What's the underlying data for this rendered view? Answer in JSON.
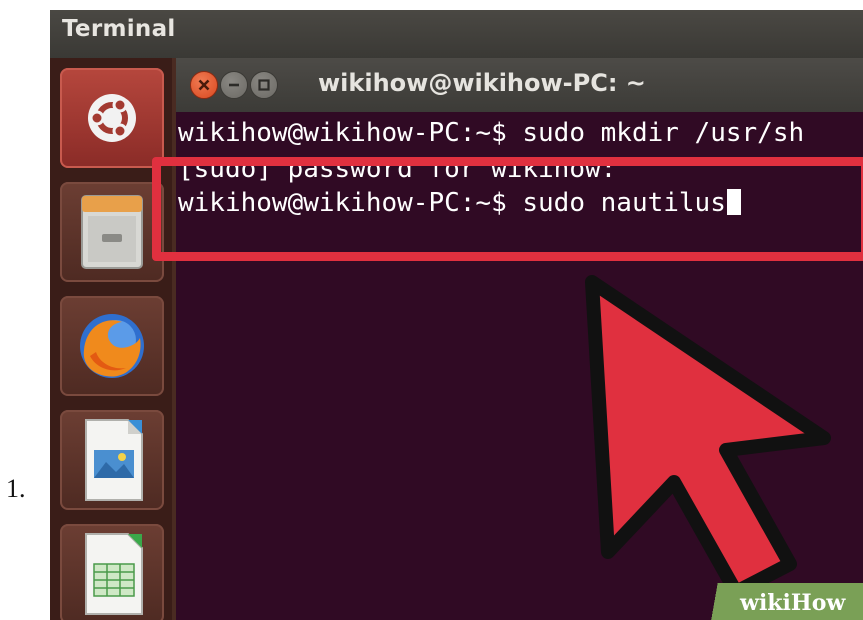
{
  "list_number": "1.",
  "topbar": {
    "title": "Terminal"
  },
  "launcher": {
    "items": [
      {
        "name": "ubuntu-logo-icon",
        "active": true
      },
      {
        "name": "file-cabinet-icon",
        "active": false
      },
      {
        "name": "firefox-icon",
        "active": false
      },
      {
        "name": "libreoffice-impress-icon",
        "active": false
      },
      {
        "name": "libreoffice-calc-icon",
        "active": false
      }
    ]
  },
  "window": {
    "title": "wikihow@wikihow-PC: ~"
  },
  "terminal": {
    "lines": [
      "wikihow@wikihow-PC:~$ sudo mkdir /usr/sh",
      "[sudo] password for wikihow:",
      "wikihow@wikihow-PC:~$ sudo nautilus"
    ]
  },
  "colors": {
    "highlight": "#e0303f",
    "terminal_bg": "#300a24",
    "pointer_fill": "#e0303f"
  },
  "watermark": {
    "part1": "wiki",
    "part2": "How"
  }
}
